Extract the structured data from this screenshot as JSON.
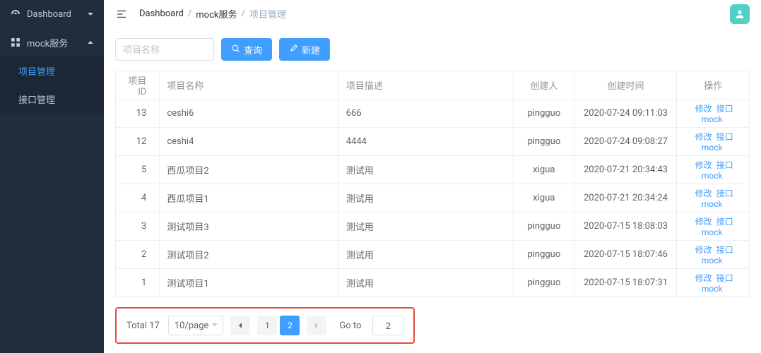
{
  "sidebar": {
    "dashboard": "Dashboard",
    "mock": "mock服务",
    "sub_project": "项目管理",
    "sub_interface": "接口管理"
  },
  "breadcrumb": [
    "Dashboard",
    "mock服务",
    "项目管理"
  ],
  "search": {
    "placeholder": "项目名称",
    "query_btn": "查询",
    "new_btn": "新建"
  },
  "table": {
    "cols": {
      "id": "项目ID",
      "name": "项目名称",
      "desc": "项目描述",
      "creator": "创建人",
      "time": "创建时间",
      "action": "操作"
    },
    "action_edit": "修改",
    "action_mock": "接口mock",
    "rows": [
      {
        "id": "13",
        "name": "ceshi6",
        "desc": "666",
        "creator": "pingguo",
        "time": "2020-07-24 09:11:03"
      },
      {
        "id": "12",
        "name": "ceshi4",
        "desc": "4444",
        "creator": "pingguo",
        "time": "2020-07-24 09:08:27"
      },
      {
        "id": "5",
        "name": "西瓜项目2",
        "desc": "测试用",
        "creator": "xigua",
        "time": "2020-07-21 20:34:43"
      },
      {
        "id": "4",
        "name": "西瓜项目1",
        "desc": "测试用",
        "creator": "xigua",
        "time": "2020-07-21 20:34:24"
      },
      {
        "id": "3",
        "name": "测试项目3",
        "desc": "测试用",
        "creator": "pingguo",
        "time": "2020-07-15 18:08:03"
      },
      {
        "id": "2",
        "name": "测试项目2",
        "desc": "测试用",
        "creator": "pingguo",
        "time": "2020-07-15 18:07:46"
      },
      {
        "id": "1",
        "name": "测试项目1",
        "desc": "测试用",
        "creator": "pingguo",
        "time": "2020-07-15 18:07:31"
      }
    ]
  },
  "pager": {
    "total_label": "Total 17",
    "page_size": "10/page",
    "pages": [
      "1",
      "2"
    ],
    "active_page": "2",
    "goto_label": "Go to",
    "goto_value": "2"
  }
}
